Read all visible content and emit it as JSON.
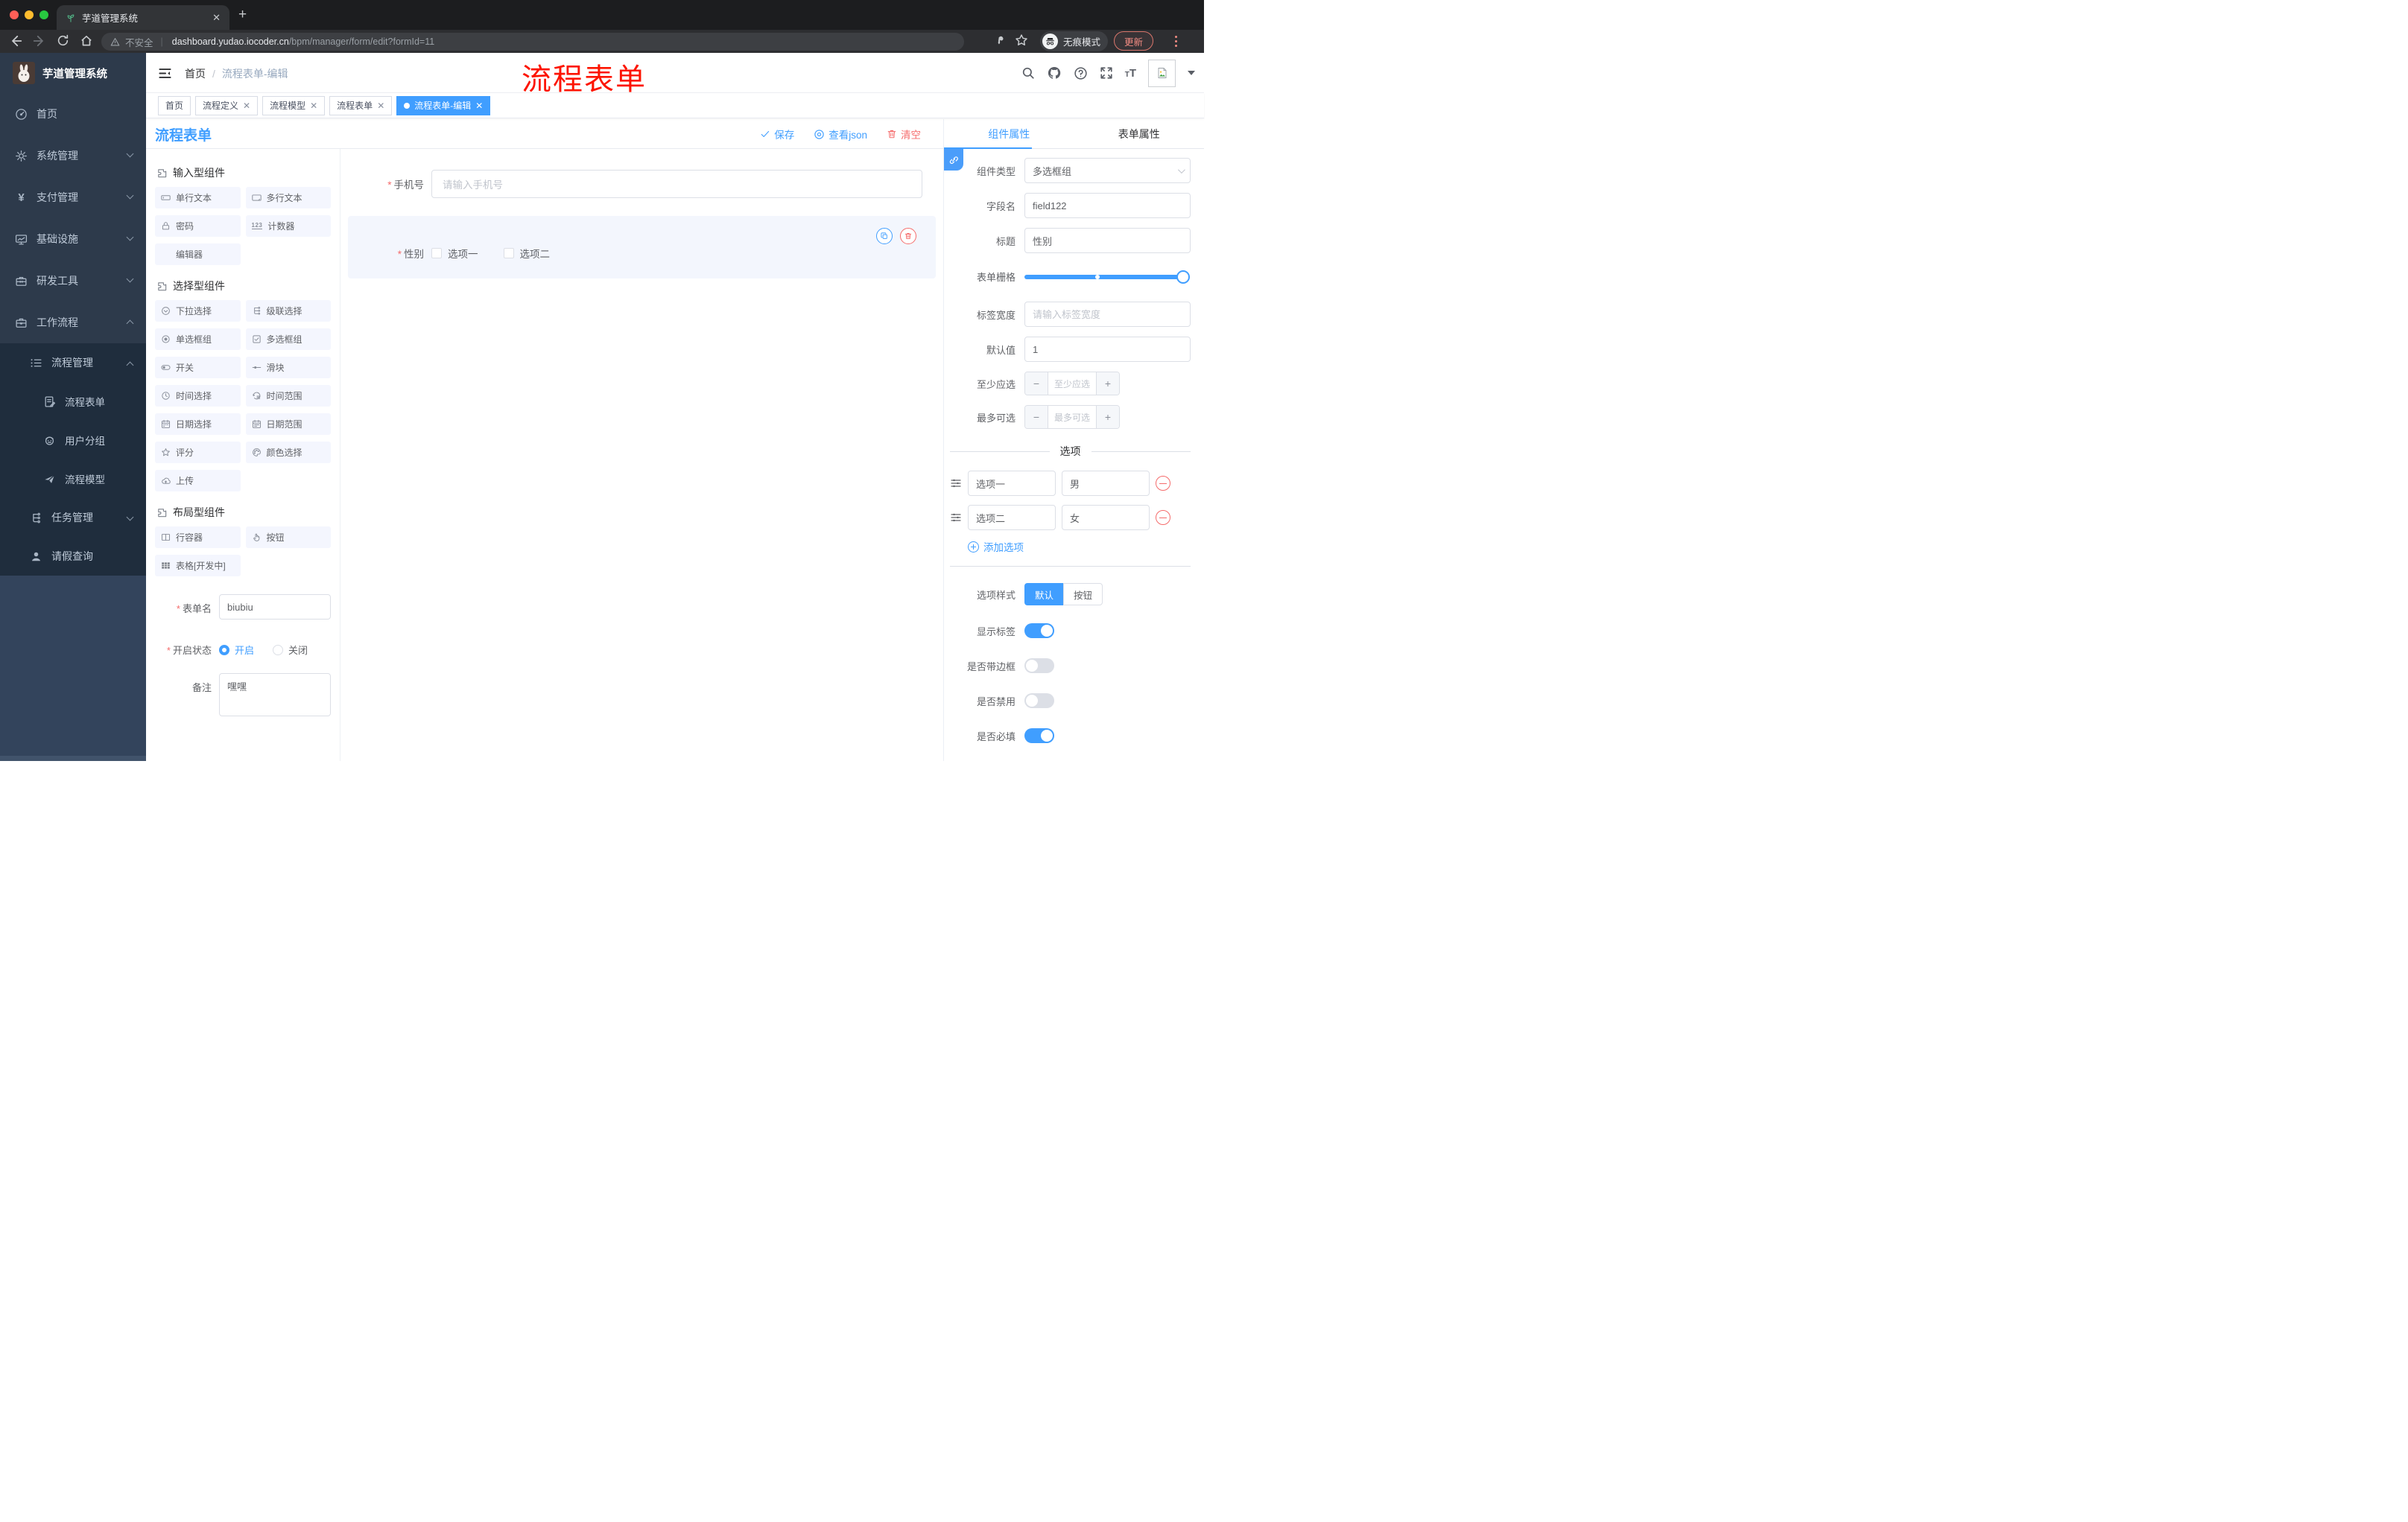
{
  "colors": {
    "accent": "#409EFF",
    "danger": "#F56C6C",
    "annotation": "#FD1400",
    "tab_active_bg": "#409EFF",
    "sidebar_bg": "#2D3A4B",
    "submenu_bg": "#1F2D3D"
  },
  "browser": {
    "tab_title": "芋道管理系统",
    "security_label": "不安全",
    "url_domain": "dashboard.yudao.iocoder.cn",
    "url_path": "/bpm/manager/form/edit?formId=11",
    "incognito_label": "无痕模式",
    "update_label": "更新"
  },
  "sidebar": {
    "logo_title": "芋道管理系统",
    "items": [
      {
        "label": "首页",
        "icon": "dashboard-icon"
      },
      {
        "label": "系统管理",
        "icon": "gear-icon",
        "arrow": "down"
      },
      {
        "label": "支付管理",
        "icon": "yen-icon",
        "arrow": "down"
      },
      {
        "label": "基础设施",
        "icon": "monitor-icon",
        "arrow": "down"
      },
      {
        "label": "研发工具",
        "icon": "toolbox-icon",
        "arrow": "down"
      },
      {
        "label": "工作流程",
        "icon": "briefcase-icon",
        "arrow": "up"
      },
      {
        "label": "流程管理",
        "icon": "flow-list-icon",
        "arrow": "up"
      },
      {
        "label": "流程表单",
        "icon": "form-doc-icon"
      },
      {
        "label": "用户分组",
        "icon": "robot-icon"
      },
      {
        "label": "流程模型",
        "icon": "paper-plane-icon"
      },
      {
        "label": "任务管理",
        "icon": "tree-icon",
        "arrow": "down"
      },
      {
        "label": "请假查询",
        "icon": "user-icon"
      }
    ]
  },
  "header": {
    "breadcrumb_home": "首页",
    "breadcrumb_current": "流程表单-编辑",
    "annotation": "流程表单"
  },
  "tags": [
    {
      "label": "首页"
    },
    {
      "label": "流程定义"
    },
    {
      "label": "流程模型"
    },
    {
      "label": "流程表单"
    },
    {
      "label": "流程表单-编辑",
      "active": true
    }
  ],
  "designer": {
    "title": "流程表单",
    "save_label": "保存",
    "view_json_label": "查看json",
    "clear_label": "清空",
    "sections": [
      {
        "title": "输入型组件",
        "items": [
          {
            "label": "单行文本",
            "icon": "input-icon"
          },
          {
            "label": "多行文本",
            "icon": "textarea-icon"
          },
          {
            "label": "密码",
            "icon": "lock-icon"
          },
          {
            "label": "计数器",
            "icon": "counter-icon"
          },
          {
            "label": "编辑器",
            "icon": ""
          }
        ]
      },
      {
        "title": "选择型组件",
        "items": [
          {
            "label": "下拉选择",
            "icon": "select-icon"
          },
          {
            "label": "级联选择",
            "icon": "cascader-icon"
          },
          {
            "label": "单选框组",
            "icon": "radio-icon"
          },
          {
            "label": "多选框组",
            "icon": "checkbox-icon"
          },
          {
            "label": "开关",
            "icon": "switch-icon"
          },
          {
            "label": "滑块",
            "icon": "slider-icon"
          },
          {
            "label": "时间选择",
            "icon": "time-icon"
          },
          {
            "label": "时间范围",
            "icon": "time-range-icon"
          },
          {
            "label": "日期选择",
            "icon": "date-icon"
          },
          {
            "label": "日期范围",
            "icon": "date-range-icon"
          },
          {
            "label": "评分",
            "icon": "star-icon"
          },
          {
            "label": "颜色选择",
            "icon": "palette-icon"
          },
          {
            "label": "上传",
            "icon": "upload-icon"
          }
        ]
      },
      {
        "title": "布局型组件",
        "items": [
          {
            "label": "行容器",
            "icon": "row-icon"
          },
          {
            "label": "按钮",
            "icon": "button-icon"
          },
          {
            "label": "表格[开发中]",
            "icon": "table-icon"
          }
        ]
      }
    ],
    "meta_form": {
      "name_label": "表单名",
      "name_value": "biubiu",
      "status_label": "开启状态",
      "status_on": "开启",
      "status_off": "关闭",
      "status_value": "开启",
      "remark_label": "备注",
      "remark_value": "嘿嘿"
    }
  },
  "canvas": {
    "phone": {
      "label": "手机号",
      "placeholder": "请输入手机号",
      "required": true
    },
    "gender": {
      "label": "性别",
      "option1": "选项一",
      "option2": "选项二",
      "required": true
    }
  },
  "props": {
    "tab_component": "组件属性",
    "tab_form": "表单属性",
    "component_type_label": "组件类型",
    "component_type_value": "多选框组",
    "field_name_label": "字段名",
    "field_name_value": "field122",
    "title_label": "标题",
    "title_value": "性别",
    "grid_label": "表单栅格",
    "label_width_label": "标签宽度",
    "label_width_placeholder": "请输入标签宽度",
    "default_label": "默认值",
    "default_value": "1",
    "min_label": "至少应选",
    "min_placeholder": "至少应选",
    "max_label": "最多可选",
    "max_placeholder": "最多可选",
    "options_title": "选项",
    "options": [
      {
        "label": "选项一",
        "value": "男"
      },
      {
        "label": "选项二",
        "value": "女"
      }
    ],
    "add_option_label": "添加选项",
    "style_label": "选项样式",
    "style_default": "默认",
    "style_button": "按钮",
    "style_selected": "默认",
    "switch_show_label": {
      "label": "显示标签",
      "on": true
    },
    "switch_border": {
      "label": "是否带边框",
      "on": false
    },
    "switch_disabled": {
      "label": "是否禁用",
      "on": false
    },
    "switch_required": {
      "label": "是否必填",
      "on": true
    }
  }
}
